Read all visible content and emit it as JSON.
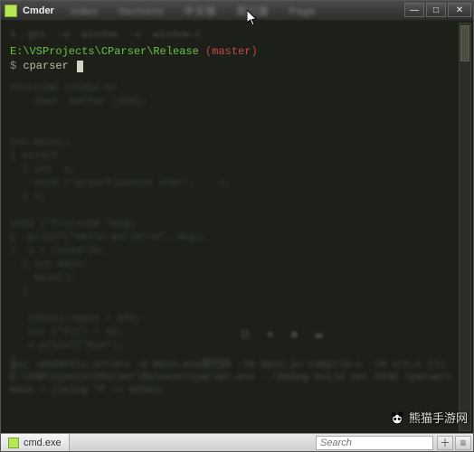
{
  "window": {
    "app_name": "Cmder",
    "title_blur_items": [
      "index",
      "Sections",
      "中文版",
      "菜口面",
      "Page"
    ]
  },
  "controls": {
    "minimize": "—",
    "maximize": "□",
    "close": "✕"
  },
  "terminal": {
    "top_blur": "λ  gcc  -o  window  -c  window.c",
    "path": "E:\\VSProjects\\CParser\\Release",
    "branch": "(master)",
    "prompt_symbol": "$",
    "command": "cparser",
    "faint_body": "#include <stdio.h>\n    char  buffer [256];\n\n\nint main()\n{ struct\n  { int  x;\n    void (*printf)(const char*, ...);\n  } s;\n\nvoid (*fn)(void *msg)\n{  printf(\"Hello World!\\n\", msg);\n}  s = (void*)0;\n  { int main;\n    main();\n  }\n\n   (this)->main = &fn;\n   int (*f)() = 42;\n   s.printf(\"bye\");\n}",
    "bottom_blur": "gcc -pedantic-errors -o main.exe源代码 -lm main.in compile.c -lm src.c\n(1) E:\\VSProjects\\CParser\\Release\\cparser.exe\n..\\Debug build ver.2048\n<parser> main = (using *f == &256);"
  },
  "statusbar": {
    "tab_label": "cmd.exe",
    "search_placeholder": "Search"
  },
  "watermark": {
    "text": "熊猫手游网"
  }
}
